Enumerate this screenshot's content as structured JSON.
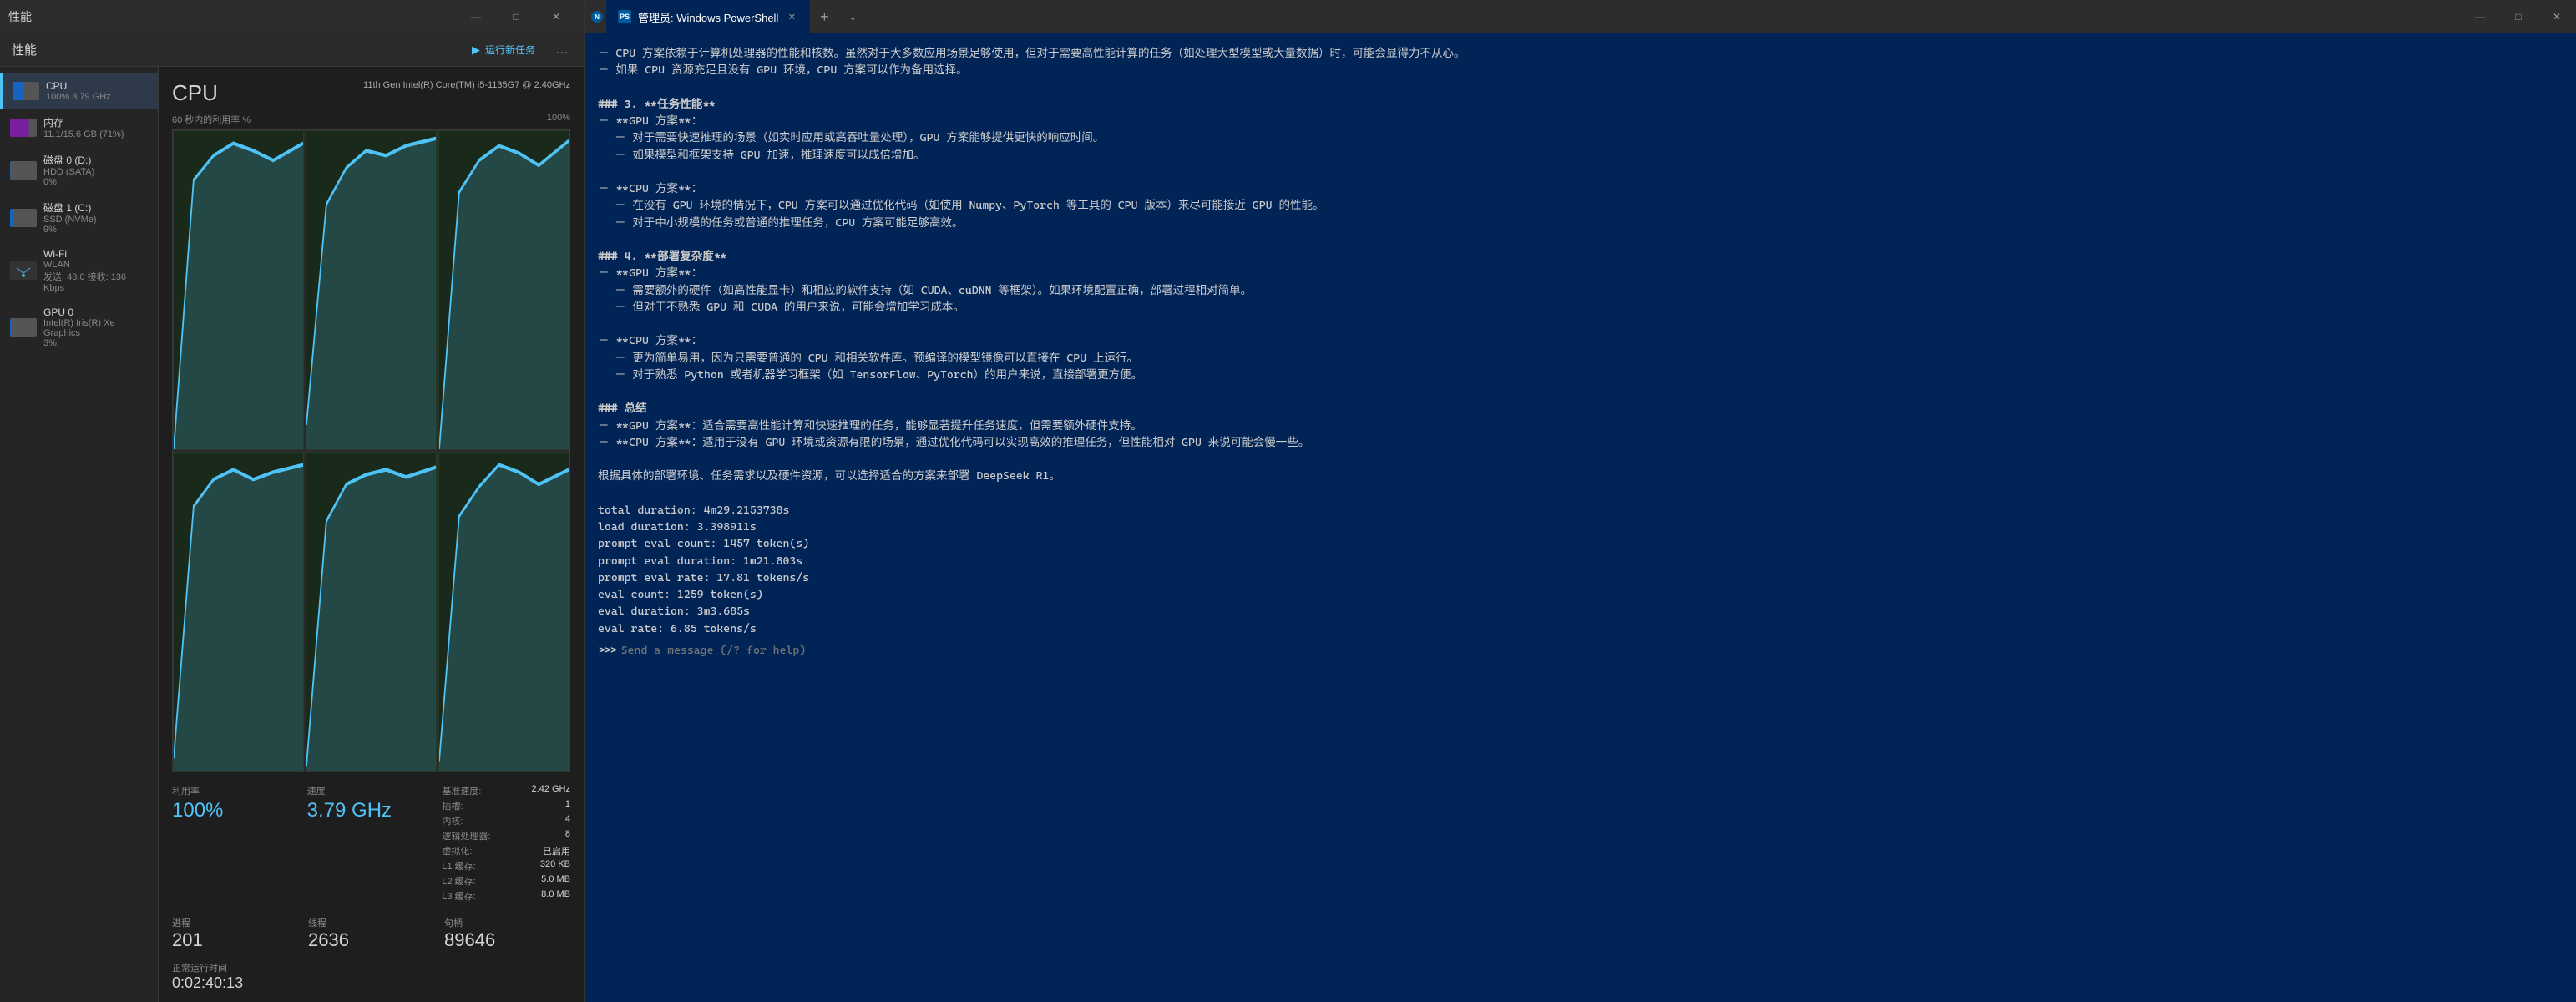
{
  "taskmanager": {
    "title": "性能",
    "run_task_label": "运行新任务",
    "cpu": {
      "title": "CPU",
      "model": "11th Gen Intel(R) Core(TM) i5-1135G7 @ 2.40GHz",
      "chart_label": "60 秒内的利用率 %",
      "chart_max": "100%",
      "utilization_label": "利用率",
      "utilization_value": "100%",
      "speed_label": "速度",
      "speed_value": "3.79 GHz",
      "base_speed_label": "基准速度:",
      "base_speed_value": "2.42 GHz",
      "sockets_label": "插槽:",
      "sockets_value": "1",
      "cores_label": "内核:",
      "cores_value": "4",
      "logical_label": "逻辑处理器:",
      "logical_value": "8",
      "virtualization_label": "虚拟化:",
      "virtualization_value": "已启用",
      "l1_label": "L1 缓存:",
      "l1_value": "320 KB",
      "l2_label": "L2 缓存:",
      "l2_value": "5.0 MB",
      "l3_label": "L3 缓存:",
      "l3_value": "8.0 MB",
      "processes_label": "进程",
      "processes_value": "201",
      "threads_label": "线程",
      "threads_value": "2636",
      "handles_label": "句柄",
      "handles_value": "89646",
      "uptime_label": "正常运行时间",
      "uptime_value": "0:02:40:13"
    },
    "sidebar": {
      "items": [
        {
          "name": "CPU",
          "sub": "100% 3.79 GHz",
          "type": "cpu",
          "active": true
        },
        {
          "name": "内存",
          "sub": "11.1/15.6 GB (71%)",
          "type": "memory",
          "active": false
        },
        {
          "name": "磁盘 0 (D:)",
          "sub": "HDD (SATA)",
          "sub2": "0%",
          "type": "disk0",
          "active": false
        },
        {
          "name": "磁盘 1 (C:)",
          "sub": "SSD (NVMe)",
          "sub2": "9%",
          "type": "disk1",
          "active": false
        },
        {
          "name": "Wi-Fi",
          "sub": "WLAN",
          "sub2": "发送: 48.0  接收: 136 Kbps",
          "type": "wifi",
          "active": false
        },
        {
          "name": "GPU 0",
          "sub": "Intel(R) Iris(R) Xe Graphics",
          "sub2": "3%",
          "type": "gpu",
          "active": false
        }
      ]
    }
  },
  "powershell": {
    "tab_label": "管理员: Windows PowerShell",
    "window_icon": "PS",
    "content": {
      "lines": [
        "－ CPU 方案依赖于计算机处理器的性能和核数。虽然对于大多数应用场景足够使用，但对于需要高性能计算的任务（如处理大型模型或大量数据）时，可能会显得力不从心。",
        "－ 如果 CPU 资源充足且没有 GPU 环境，CPU 方案可以作为备用选择。",
        "",
        "### 3. **任务性能**",
        "－ **GPU 方案**：",
        "  － 对于需要快速推理的场景（如实时应用或高吞吐量处理），GPU 方案能够提供更快的响应时间。",
        "  － 如果模型和框架支持 GPU 加速，推理速度可以成倍增加。",
        "",
        "－ **CPU 方案**：",
        "  － 在没有 GPU 环境的情况下，CPU 方案可以通过优化代码（如使用 Numpy、PyTorch 等工具的 CPU 版本）来尽可能接近 GPU 的性能。",
        "  － 对于中小规模的任务或普通的推理任务，CPU 方案可能足够高效。",
        "",
        "### 4. **部署复杂度**",
        "－ **GPU 方案**：",
        "  － 需要额外的硬件（如高性能显卡）和相应的软件支持（如 CUDA、cuDNN 等框架）。如果环境配置正确，部署过程相对简单。",
        "  － 但对于不熟悉 GPU 和 CUDA 的用户来说，可能会增加学习成本。",
        "",
        "－ **CPU 方案**：",
        "  － 更为简单易用，因为只需要普通的 CPU 和相关软件库。预编译的模型镜像可以直接在 CPU 上运行。",
        "  － 对于熟悉 Python 或者机器学习框架（如 TensorFlow、PyTorch）的用户来说，直接部署更方便。",
        "",
        "### 总结",
        "－ **GPU 方案**：适合需要高性能计算和快速推理的任务，能够显著提升任务速度，但需要额外硬件支持。",
        "－ **CPU 方案**：适用于没有 GPU 环境或资源有限的场景，通过优化代码可以实现高效的推理任务，但性能相对 GPU 来说可能会慢一些。",
        "",
        "根据具体的部署环境、任务需求以及硬件资源，可以选择适合的方案来部署 DeepSeek R1。",
        "",
        "total duration:     4m29.2153738s",
        "load duration:      3.398911s",
        "prompt eval count:  1457 token(s)",
        "prompt eval duration: 1m21.803s",
        "prompt eval rate:   17.81 tokens/s",
        "eval count:         1259 token(s)",
        "eval duration:      3m3.685s",
        "eval rate:          6.85 tokens/s"
      ],
      "prompt": ">>>",
      "prompt_placeholder": "Send a message (/? for help)"
    }
  }
}
